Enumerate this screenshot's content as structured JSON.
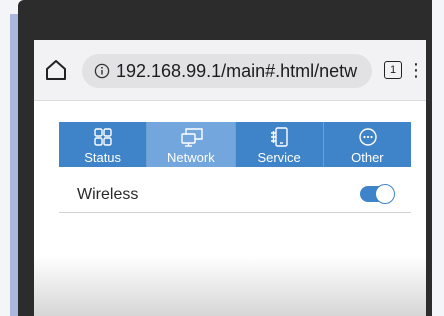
{
  "browser": {
    "url": "192.168.99.1/main#.html/netw",
    "tab_count": "1",
    "icons": {
      "home": "home-icon",
      "info": "info-icon",
      "menu": "kebab-menu-icon"
    }
  },
  "nav": {
    "tabs": [
      {
        "label": "Status",
        "icon": "status-grid-icon",
        "active": false
      },
      {
        "label": "Network",
        "icon": "network-monitors-icon",
        "active": true
      },
      {
        "label": "Service",
        "icon": "service-device-icon",
        "active": false
      },
      {
        "label": "Other",
        "icon": "other-dots-icon",
        "active": false
      }
    ]
  },
  "settings": {
    "wireless_label": "Wireless",
    "wireless_enabled": true
  },
  "colors": {
    "accent": "#3f84c8",
    "active_tab": "#72a6dc",
    "page_background": "#f4f5f9",
    "side_accent": "#a9b8dc"
  }
}
